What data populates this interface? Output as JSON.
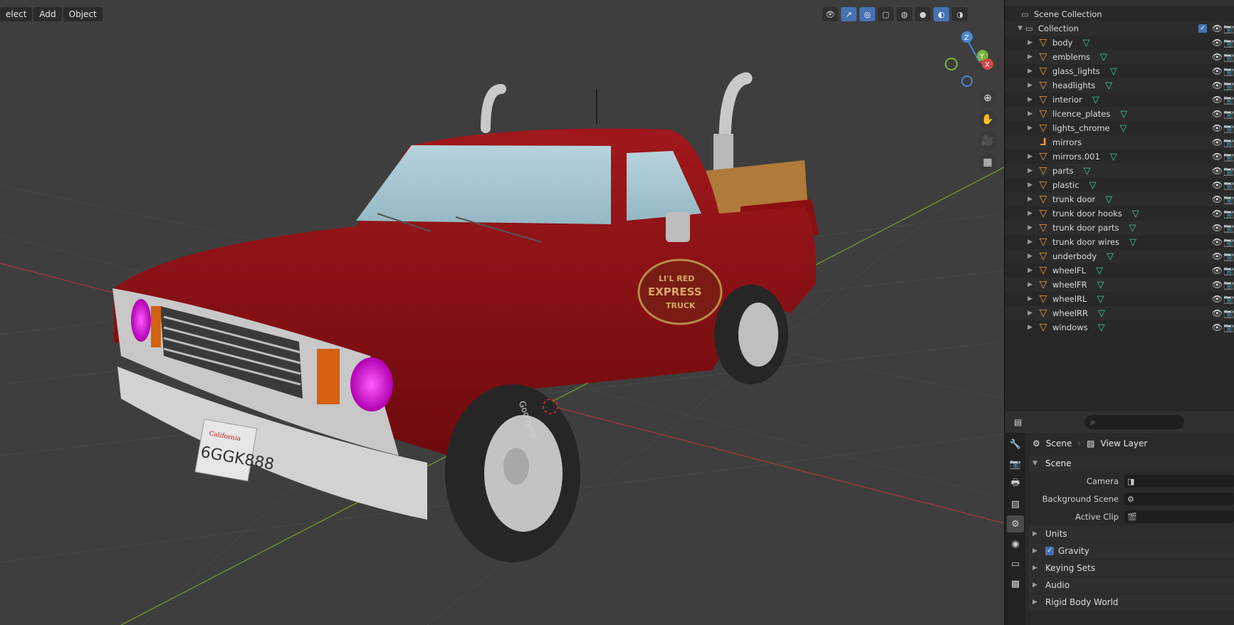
{
  "viewport": {
    "menu": [
      "elect",
      "Add",
      "Object"
    ],
    "plate_text": "6GGK888",
    "plate_state": "California",
    "door_logo": [
      "LI'L RED",
      "EXPRESS",
      "TRUCK"
    ],
    "tire_text": "Goodyear",
    "gizmo": {
      "z": "Z",
      "y": "Y",
      "x": "X"
    }
  },
  "outliner": {
    "scene_collection": "Scene Collection",
    "collection": "Collection",
    "items": [
      {
        "name": "body",
        "type": "mesh"
      },
      {
        "name": "emblems",
        "type": "mesh"
      },
      {
        "name": "glass_lights",
        "type": "mesh"
      },
      {
        "name": "headlights",
        "type": "mesh"
      },
      {
        "name": "interior",
        "type": "mesh"
      },
      {
        "name": "licence_plates",
        "type": "mesh"
      },
      {
        "name": "lights_chrome",
        "type": "mesh"
      },
      {
        "name": "mirrors",
        "type": "empty"
      },
      {
        "name": "mirrors.001",
        "type": "mesh"
      },
      {
        "name": "parts",
        "type": "mesh"
      },
      {
        "name": "plastic",
        "type": "mesh"
      },
      {
        "name": "trunk door",
        "type": "mesh"
      },
      {
        "name": "trunk door hooks",
        "type": "mesh"
      },
      {
        "name": "trunk door parts",
        "type": "mesh"
      },
      {
        "name": "trunk door wires",
        "type": "mesh"
      },
      {
        "name": "underbody",
        "type": "mesh"
      },
      {
        "name": "wheelFL",
        "type": "mesh"
      },
      {
        "name": "wheelFR",
        "type": "mesh"
      },
      {
        "name": "wheelRL",
        "type": "mesh"
      },
      {
        "name": "wheelRR",
        "type": "mesh"
      },
      {
        "name": "windows",
        "type": "mesh"
      }
    ]
  },
  "properties": {
    "breadcrumb": {
      "scene": "Scene",
      "view_layer": "View Layer"
    },
    "panel_title": "Scene",
    "fields": [
      {
        "label": "Camera"
      },
      {
        "label": "Background Scene"
      },
      {
        "label": "Active Clip"
      }
    ],
    "subpanels": [
      "Units",
      "Gravity",
      "Keying Sets",
      "Audio",
      "Rigid Body World"
    ]
  },
  "colors": {
    "accent": "#4772b3",
    "mesh_icon": "#ef9a3c",
    "truck_red": "#8b0f12"
  }
}
